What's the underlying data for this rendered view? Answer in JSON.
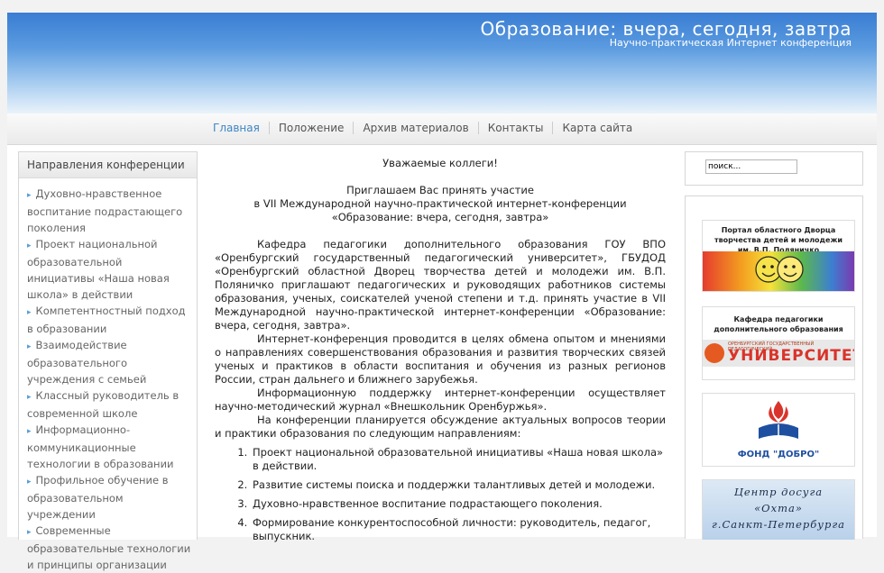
{
  "header": {
    "title": "Образование: вчера, сегодня, завтра",
    "subtitle": "Научно-практическая Интернет конференция"
  },
  "nav": {
    "items": [
      {
        "label": "Главная",
        "active": true
      },
      {
        "label": "Положение",
        "active": false
      },
      {
        "label": "Архив материалов",
        "active": false
      },
      {
        "label": "Контакты",
        "active": false
      },
      {
        "label": "Карта сайта",
        "active": false
      }
    ]
  },
  "sidebar": {
    "title": "Направления конференции",
    "items": [
      "Духовно-нравственное воспитание подрастающего поколения",
      "Проект национальной образовательной инициативы «Наша новая школа» в действии",
      "Компетентностный подход в образовании",
      "Взаимодействие образовательного учреждения с семьей",
      "Классный руководитель в современной школе",
      "Информационно-коммуникационные технологии в образовании",
      "Профильное обучение в образовательном учреждении",
      "Современные образовательные технологии и принципы организации"
    ]
  },
  "main": {
    "greeting": "Уважаемые коллеги!",
    "invite_line1": "Приглашаем Вас принять участие",
    "invite_line2": "в VII Международной научно-практической интернет-конференции «Образование: вчера, сегодня, завтра»",
    "paragraphs": [
      "Кафедра педагогики дополнительного образования ГОУ ВПО «Оренбургский государственный педагогический университет», ГБУДОД «Оренбургский областной Дворец творчества детей и молодежи им. В.П. Поляничко приглашают педагогических и руководящих работников системы образования, ученых, соискателей ученой степени и т.д. принять участие в VII Международной научно-практической интернет-конференции «Образование: вчера, сегодня, завтра».",
      "Интернет-конференция проводится в целях обмена опытом и мнениями о направлениях совершенствования образования и развития творческих связей ученых и практиков в области воспитания и обучения из разных регионов России, стран дальнего и ближнего зарубежья.",
      "Информационную поддержку интернет-конференции осуществляет научно-методический журнал «Внешкольник Оренбуржья».",
      "На конференции планируется обсуждение актуальных вопросов теории и практики образования по следующим направлениям:"
    ],
    "topics": [
      "Проект национальной образовательной инициативы «Наша новая школа» в действии.",
      "Развитие системы поиска и поддержки талантливых детей и молодежи.",
      "Духовно-нравственное воспитание подрастающего поколения.",
      "Формирование конкурентоспособной личности: руководитель, педагог, выпускник."
    ]
  },
  "search": {
    "value": "поиск..."
  },
  "banners": {
    "palace": "Портал областного Дворца творчества детей и молодежи им. В.П. Поляничко",
    "dept": "Кафедра педагогики дополнительного образования",
    "univ_small": "ОРЕНБУРГСКИЙ ГОСУДАРСТВЕННЫЙ ПЕДАГОГИЧЕСКИЙ",
    "univ": "УНИВЕРСИТЕТ",
    "fund": "ФОНД \"ДОБРО\"",
    "okhta1": "Центр досуга",
    "okhta2": "«Охта»",
    "okhta3": "г.Санкт-Петербурга"
  },
  "colors": {
    "accent": "#3d86c6",
    "header_top": "#3a7dd3",
    "banner_red": "#d9342b"
  }
}
